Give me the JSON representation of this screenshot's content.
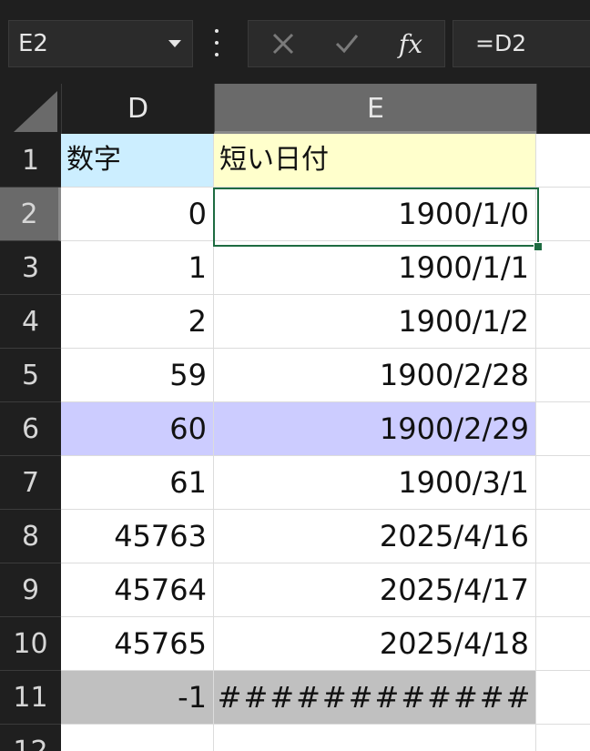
{
  "name_box": {
    "value": "E2"
  },
  "formula_bar": {
    "cancel_icon": "close-icon",
    "enter_icon": "check-icon",
    "function_label": "fx",
    "formula": "=D2"
  },
  "columns": [
    "D",
    "E",
    ""
  ],
  "rows": [
    {
      "num": "1",
      "d": "数字",
      "e": "短い日付"
    },
    {
      "num": "2",
      "d": "0",
      "e": "1900/1/0"
    },
    {
      "num": "3",
      "d": "1",
      "e": "1900/1/1"
    },
    {
      "num": "4",
      "d": "2",
      "e": "1900/1/2"
    },
    {
      "num": "5",
      "d": "59",
      "e": "1900/2/28"
    },
    {
      "num": "6",
      "d": "60",
      "e": "1900/2/29"
    },
    {
      "num": "7",
      "d": "61",
      "e": "1900/3/1"
    },
    {
      "num": "8",
      "d": "45763",
      "e": "2025/4/16"
    },
    {
      "num": "9",
      "d": "45764",
      "e": "2025/4/17"
    },
    {
      "num": "10",
      "d": "45765",
      "e": "2025/4/18"
    },
    {
      "num": "11",
      "d": "-1",
      "e": "############"
    },
    {
      "num": "12",
      "d": "",
      "e": ""
    }
  ],
  "colors": {
    "header_d": "#cceeff",
    "header_e": "#ffffcc",
    "highlight_row": "#ccccff",
    "error_row": "#c0c0c0",
    "selection": "#1e6b41"
  }
}
